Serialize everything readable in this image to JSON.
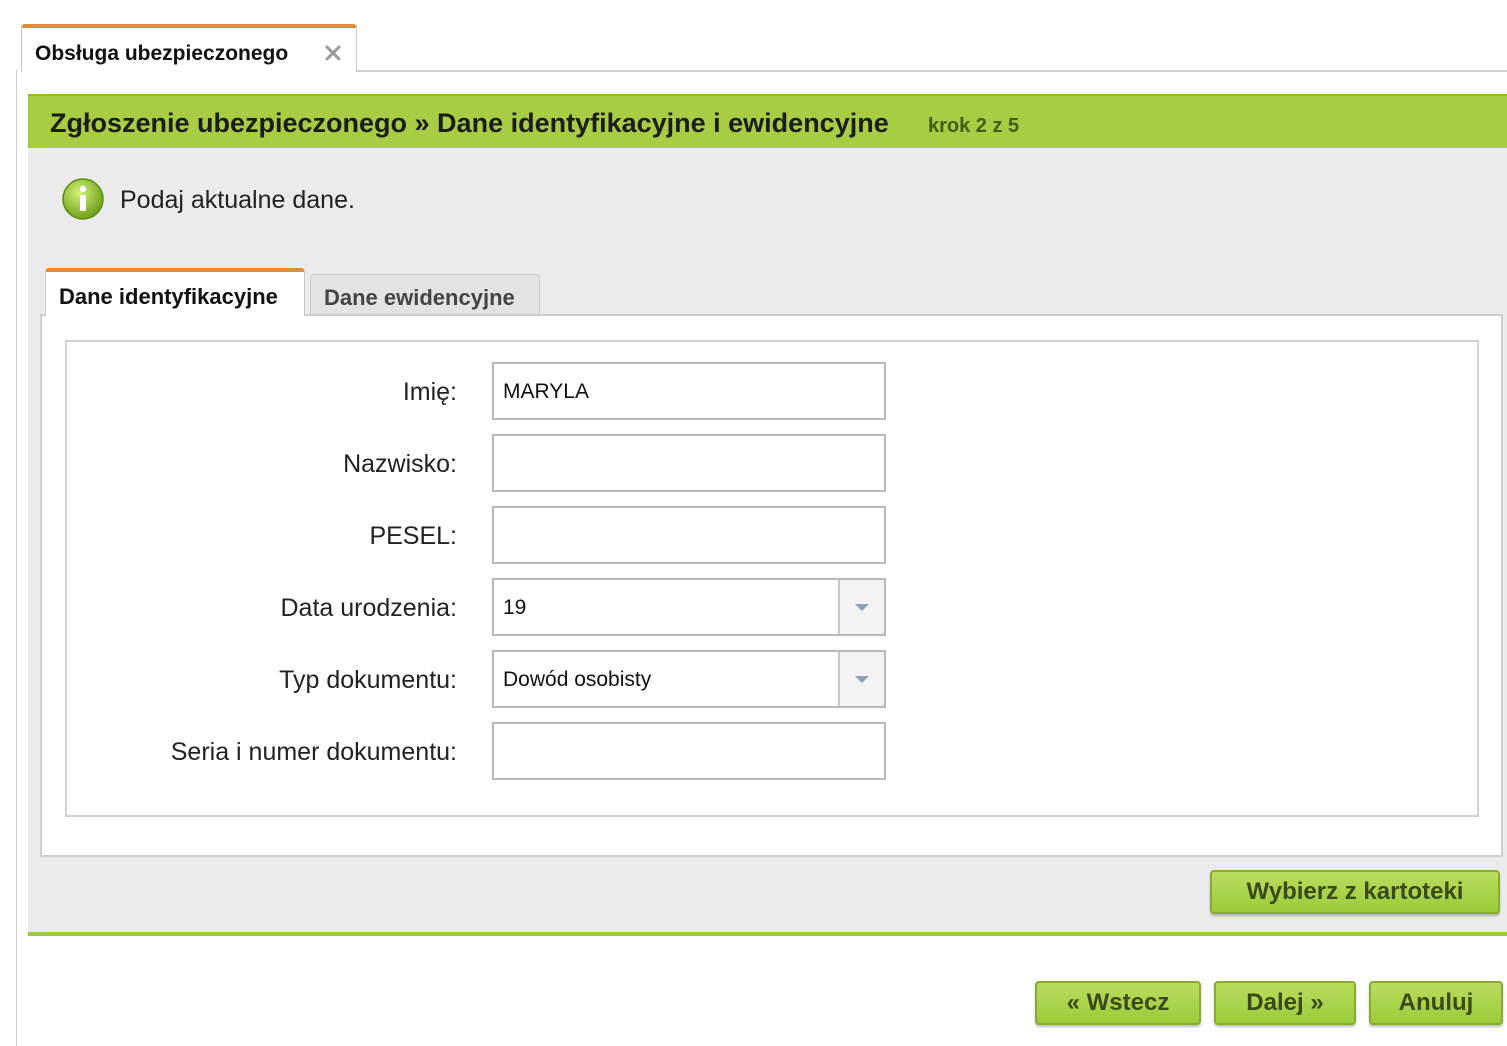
{
  "top_tab": {
    "label": "Obsługa ubezpieczonego"
  },
  "header": {
    "title": "Zgłoszenie ubezpieczonego » Dane identyfikacyjne i ewidencyjne",
    "step": "krok 2 z 5"
  },
  "info": {
    "text": "Podaj aktualne dane."
  },
  "tabs": [
    {
      "label": "Dane identyfikacyjne",
      "active": true
    },
    {
      "label": "Dane ewidencyjne",
      "active": false
    }
  ],
  "form": {
    "first_name": {
      "label": "Imię:",
      "value": "MARYLA"
    },
    "last_name": {
      "label": "Nazwisko:",
      "value": ""
    },
    "pesel": {
      "label": "PESEL:",
      "value": ""
    },
    "birth_date": {
      "label": "Data urodzenia:",
      "value": "19"
    },
    "doc_type": {
      "label": "Typ dokumentu:",
      "value": "Dowód osobisty"
    },
    "doc_number": {
      "label": "Seria i numer dokumentu:",
      "value": ""
    }
  },
  "buttons": {
    "choose_from_file": "Wybierz z kartoteki",
    "back": "« Wstecz",
    "next": "Dalej »",
    "cancel": "Anuluj"
  },
  "colors": {
    "accent_green": "#a6cd44",
    "tab_orange": "#e08a3c"
  },
  "icons": {
    "close": "close-icon",
    "info": "info-icon",
    "dropdown": "chevron-down-icon"
  }
}
